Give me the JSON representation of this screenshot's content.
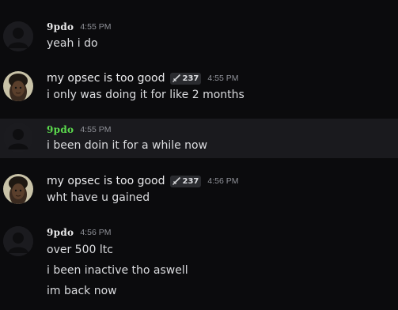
{
  "messages": [
    {
      "author": "9pdo",
      "timestamp": "4:55 PM",
      "lines": [
        "yeah i do"
      ]
    },
    {
      "author": "my opsec is too good",
      "tag": "237",
      "timestamp": "4:55 PM",
      "lines": [
        "i only was doing it for like 2 months"
      ]
    },
    {
      "author": "9pdo",
      "timestamp": "4:55 PM",
      "lines": [
        "i been doin it for a while now"
      ]
    },
    {
      "author": "my opsec is too good",
      "tag": "237",
      "timestamp": "4:56 PM",
      "lines": [
        "wht have u gained"
      ]
    },
    {
      "author": "9pdo",
      "timestamp": "4:56 PM",
      "lines": [
        "over 500 ltc",
        "i been inactive tho aswell",
        "im back now"
      ]
    }
  ],
  "colors": {
    "background": "#0b0b0d",
    "highlight_row": "#1a1a1e",
    "green_username": "#5bd94d",
    "timestamp": "#8e9097"
  }
}
